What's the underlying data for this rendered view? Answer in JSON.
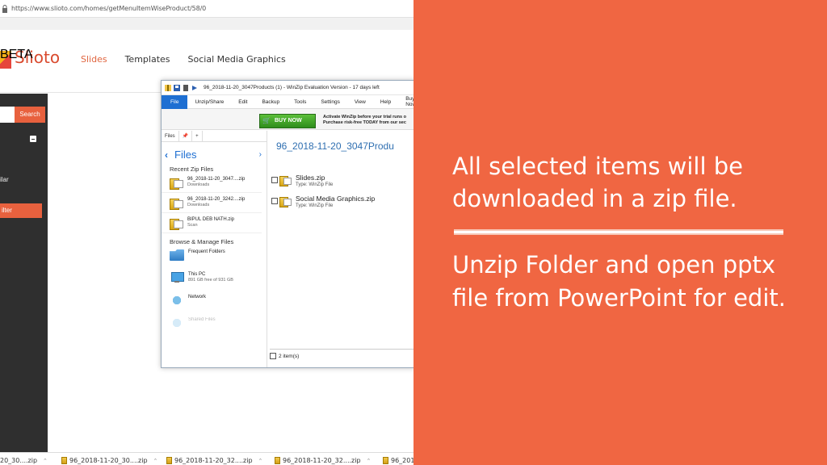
{
  "browser": {
    "url": "https://www.slioto.com/homes/getMenuItemWiseProduct/58/0"
  },
  "site": {
    "logo": "Slioto",
    "beta": "BETA",
    "nav": [
      "Slides",
      "Templates",
      "Social Media Graphics"
    ],
    "search_button": "Search",
    "sidebar_text": "ilar",
    "filter_button": "ilter"
  },
  "winzip": {
    "title": "96_2018-11-20_3047Products (1) - WinZip Evaluation Version - 17 days left",
    "menu": [
      "File",
      "Unzip/Share",
      "Edit",
      "Backup",
      "Tools",
      "Settings",
      "View",
      "Help",
      "Buy Now"
    ],
    "buy_now": "BUY NOW",
    "ad_line1": "Activate WinZip before your trial runs o",
    "ad_line2": "Purchase risk-free TODAY from our sec",
    "pane_tab": "Files",
    "pane_pin": "📌",
    "pane_plus": "+",
    "files_title": "Files",
    "recent_heading": "Recent Zip Files",
    "recent": [
      {
        "name": "96_2018-11-20_3047....zip",
        "loc": "Downloads"
      },
      {
        "name": "96_2018-11-20_3242....zip",
        "loc": "Downloads"
      },
      {
        "name": "BIPUL DEB NATH.zip",
        "loc": "Scan"
      }
    ],
    "browse_heading": "Browse & Manage Files",
    "browse": [
      {
        "name": "Frequent Folders",
        "sub": ""
      },
      {
        "name": "This PC",
        "sub": "891 GB free of 931 GB"
      },
      {
        "name": "Network",
        "sub": ""
      },
      {
        "name": "Shared Files",
        "sub": ""
      }
    ],
    "path_title": "96_2018-11-20_3047Produ",
    "files": [
      {
        "name": "Slides.zip",
        "type": "Type: WinZip File"
      },
      {
        "name": "Social Media Graphics.zip",
        "type": "Type: WinZip File"
      }
    ],
    "status": "2 item(s)"
  },
  "downloads": [
    "20_30....zip",
    "96_2018-11-20_30....zip",
    "96_2018-11-20_32....zip",
    "96_2018-11-20_32....zip",
    "96_2018"
  ],
  "panel": {
    "text1": "All selected items will be downloaded in a zip file.",
    "text2": "Unzip Folder and open pptx file from PowerPoint for edit."
  },
  "colors": {
    "accent": "#f06642",
    "winzip_blue": "#1e6fd2"
  }
}
